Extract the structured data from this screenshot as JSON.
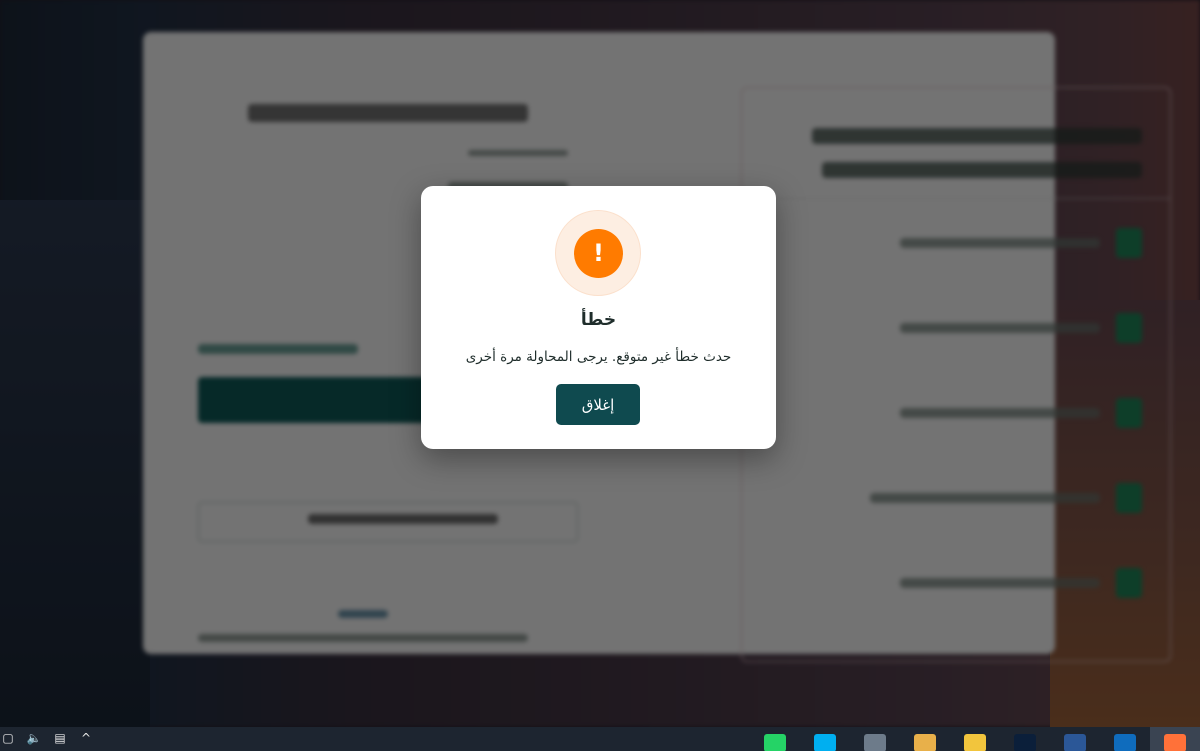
{
  "background": {
    "panel_title": "",
    "login_title": ""
  },
  "dialog": {
    "title": "خطأ",
    "message": "حدث خطأ غير متوقع. يرجى المحاولة مرة أخرى",
    "close_label": "إغلاق",
    "alert_symbol": "!",
    "icon": "warning-icon",
    "accent_color": "#ff7b00",
    "button_color": "#0f4a4f"
  },
  "taskbar": {
    "tray_icons": [
      "tablet-mode-icon",
      "volume-icon",
      "network-icon",
      "chevron-up-icon"
    ],
    "apps": [
      {
        "name": "whatsapp-icon",
        "color": "#25d366"
      },
      {
        "name": "skype-icon",
        "color": "#00aff0"
      },
      {
        "name": "calculator-icon",
        "color": "#6d7b8a"
      },
      {
        "name": "paint-icon",
        "color": "#e8b04a"
      },
      {
        "name": "file-explorer-icon",
        "color": "#f2c53d"
      },
      {
        "name": "photoshop-icon",
        "color": "#0b1f3a"
      },
      {
        "name": "word-icon",
        "color": "#2b5797"
      },
      {
        "name": "outlook-icon",
        "color": "#0f6cbd"
      },
      {
        "name": "firefox-icon",
        "color": "#ff7139"
      }
    ]
  }
}
